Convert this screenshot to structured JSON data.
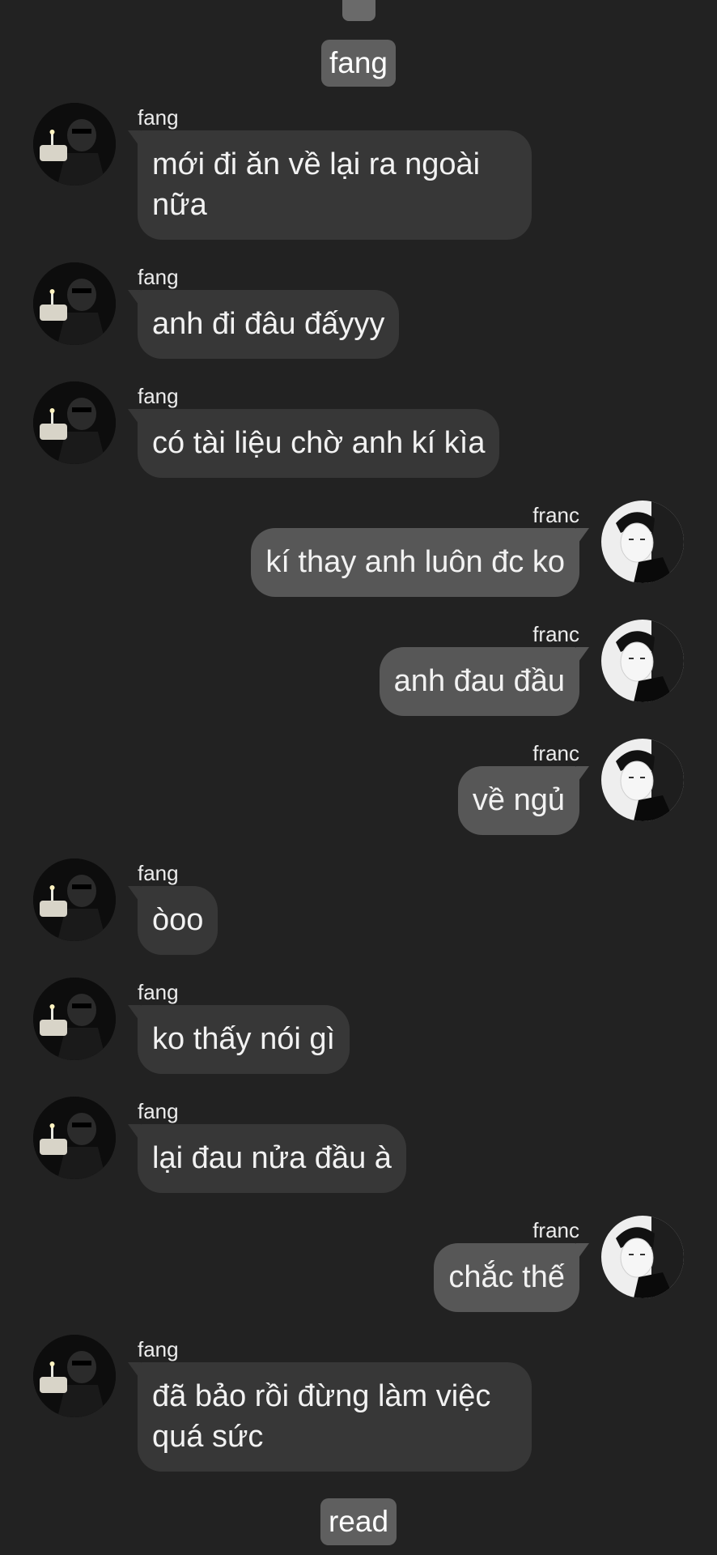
{
  "header_label": "fang",
  "footer_label": "read",
  "colors": {
    "background": "#222222",
    "incoming_bubble": "#373737",
    "outgoing_bubble": "#575757",
    "chip": "#5f5f5f"
  },
  "messages": [
    {
      "side": "left",
      "sender": "fang",
      "text": "mới đi ăn về lại ra ngoài\nnữa"
    },
    {
      "side": "left",
      "sender": "fang",
      "text": "anh đi đâu đấyyy"
    },
    {
      "side": "left",
      "sender": "fang",
      "text": "có tài liệu chờ anh kí kìa"
    },
    {
      "side": "right",
      "sender": "franc",
      "text": "kí thay anh luôn đc ko"
    },
    {
      "side": "right",
      "sender": "franc",
      "text": "anh đau đầu"
    },
    {
      "side": "right",
      "sender": "franc",
      "text": "về ngủ"
    },
    {
      "side": "left",
      "sender": "fang",
      "text": "òoo"
    },
    {
      "side": "left",
      "sender": "fang",
      "text": "ko thấy nói gì"
    },
    {
      "side": "left",
      "sender": "fang",
      "text": "lại đau nửa đầu à"
    },
    {
      "side": "right",
      "sender": "franc",
      "text": "chắc thế"
    },
    {
      "side": "left",
      "sender": "fang",
      "text": "đã bảo rồi đừng làm việc\nquá sức"
    }
  ]
}
